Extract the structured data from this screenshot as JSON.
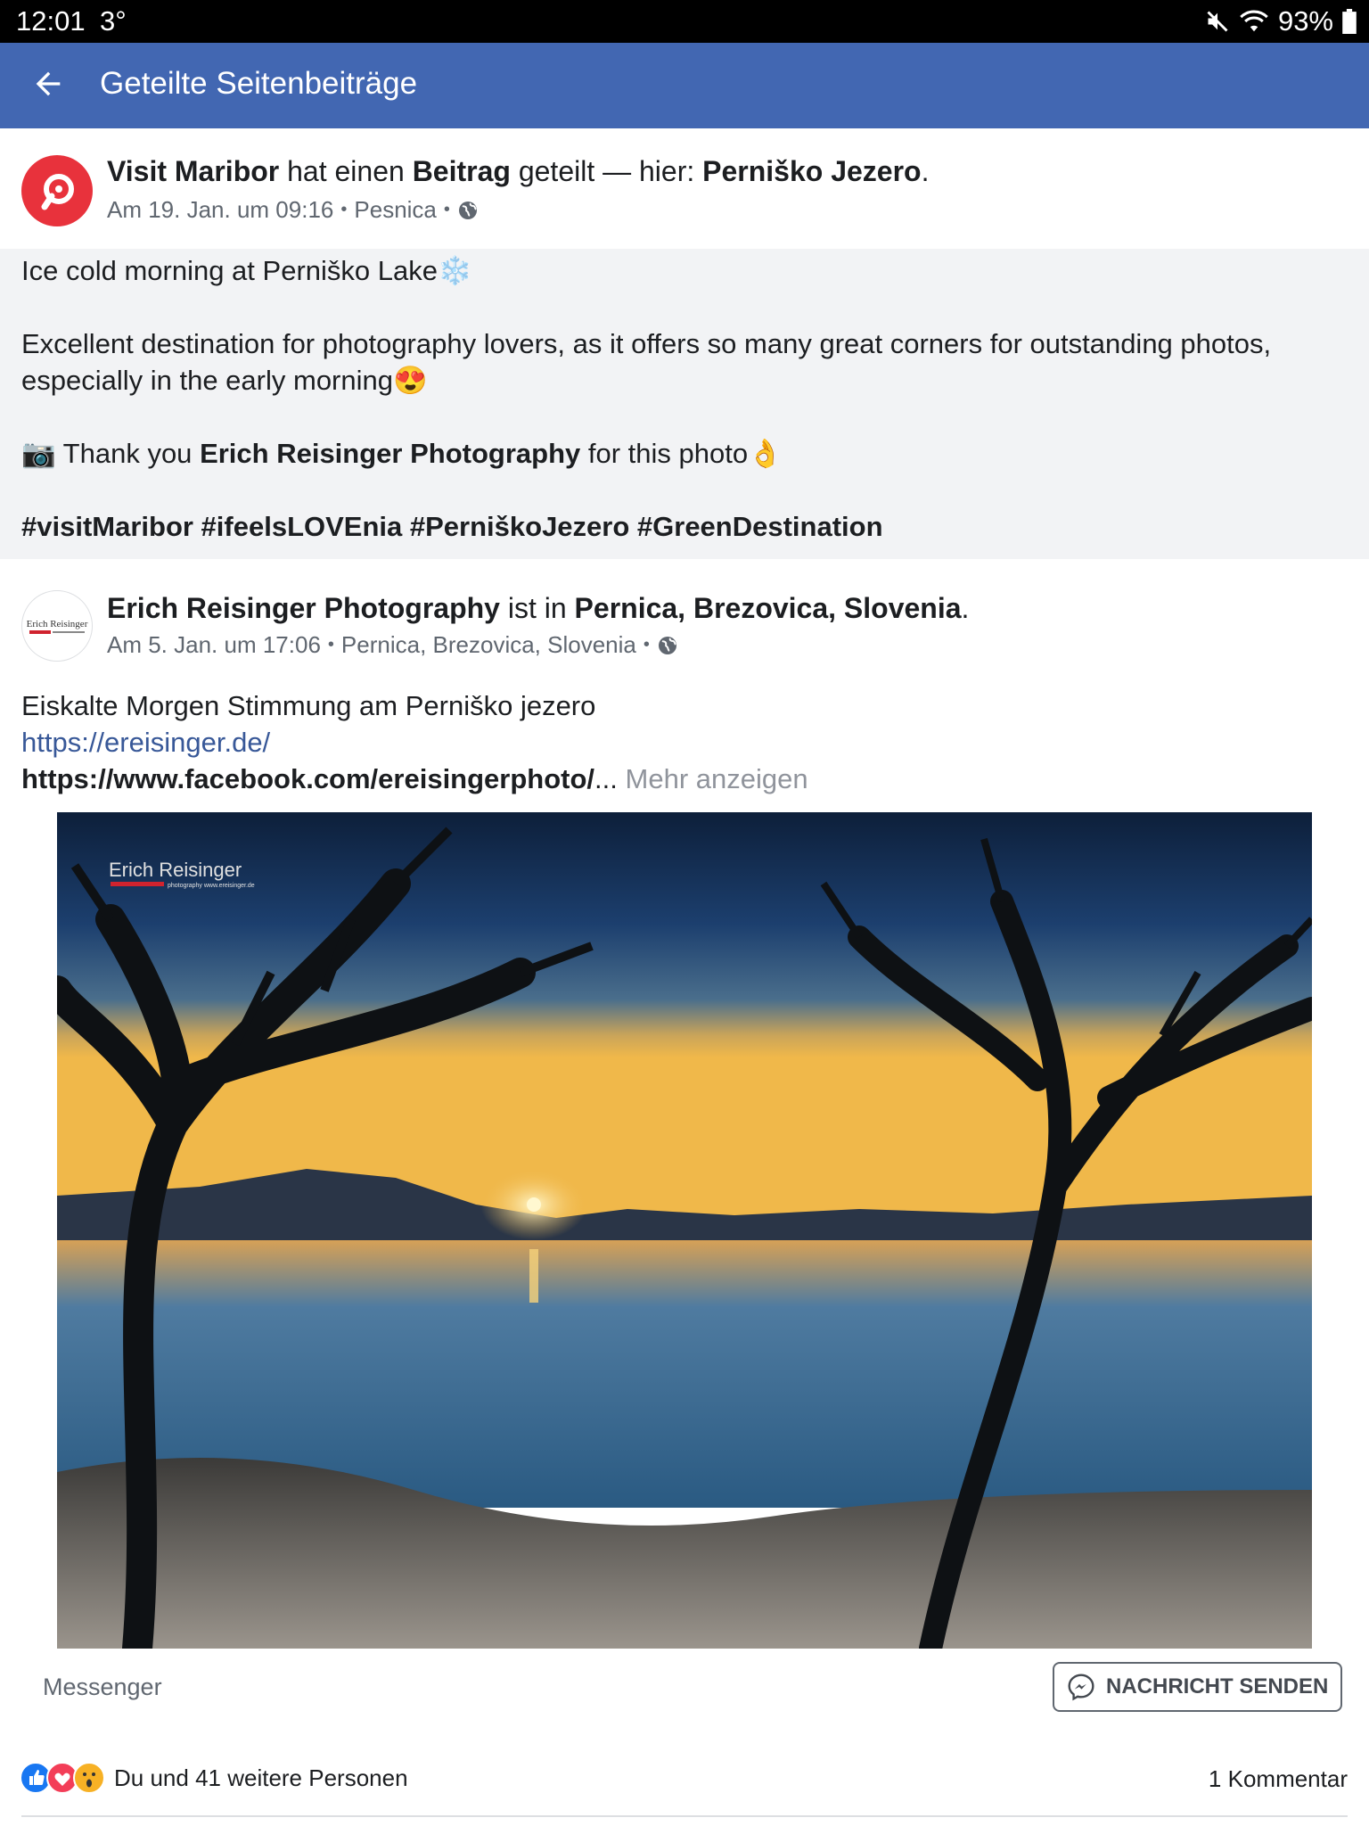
{
  "status_bar": {
    "time": "12:01",
    "temperature": "3°",
    "battery": "93%",
    "icons": [
      "mute-icon",
      "wifi-icon",
      "battery-icon"
    ]
  },
  "app_bar": {
    "title": "Geteilte Seitenbeiträge",
    "back_icon": "arrow-left-icon",
    "background": "#4267b2"
  },
  "share_post": {
    "page_name": "Visit Maribor",
    "action_mid": "hat einen",
    "action_obj": "Beitrag",
    "action_end": "geteilt — hier:",
    "place": "Perniško Jezero",
    "period": ".",
    "date": "Am 19. Jan. um 09:16",
    "location": "Pesnica",
    "avatar_color": "#e8323c",
    "line1": "Ice cold morning at Perniško Lake",
    "line1_emoji": "❄️",
    "line2": "Excellent destination for photography lovers, as it offers so many great corners for outstanding photos,",
    "line3": "especially in the early morning",
    "line3_emoji": "😍",
    "line4_emoji": "📷",
    "line4_pre": "Thank you",
    "line4_name": "Erich Reisinger Photography",
    "line4_post": "for this photo",
    "line4_emoji2": "👌",
    "hashtags": "#visitMaribor #ifeelsLOVEnia #PerniškoJezero #GreenDestination"
  },
  "original_post": {
    "author": "Erich Reisinger Photography",
    "action": "ist in",
    "location_bold": "Pernica, Brezovica, Slovenia",
    "period": ".",
    "date": "Am 5. Jan. um 17:06",
    "location": "Pernica, Brezovica, Slovenia",
    "avatar_text": "Erich Reisinger",
    "text1": "Eiskalte Morgen Stimmung am Perniško jezero",
    "link1": "https://ereisinger.de/",
    "link2": "https://www.facebook.com/ereisingerphoto/",
    "ellipsis": "...",
    "more": "Mehr anzeigen",
    "photo_watermark": "Erich Reisinger",
    "photo_watermark_sub": "photography   www.ereisinger.de"
  },
  "footer": {
    "messenger_label": "Messenger",
    "send_button": "NACHRICHT SENDEN",
    "reactions_text": "Du und 41 weitere Personen",
    "comments": "1 Kommentar",
    "reaction_icons": [
      "like-icon",
      "love-icon",
      "wow-icon"
    ]
  }
}
